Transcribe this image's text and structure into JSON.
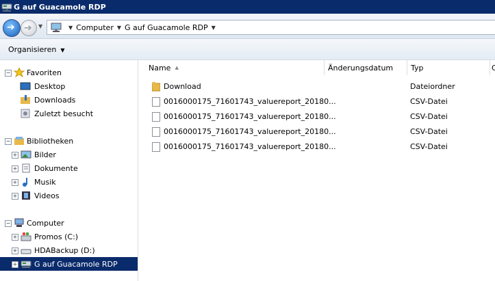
{
  "window": {
    "title": "G auf Guacamole RDP"
  },
  "address": {
    "crumbs": [
      "Computer",
      "G auf Guacamole RDP"
    ]
  },
  "toolbar": {
    "organize_label": "Organisieren"
  },
  "nav": {
    "favorites": {
      "label": "Favoriten",
      "items": [
        "Desktop",
        "Downloads",
        "Zuletzt besucht"
      ]
    },
    "libraries": {
      "label": "Bibliotheken",
      "items": [
        "Bilder",
        "Dokumente",
        "Musik",
        "Videos"
      ]
    },
    "computer": {
      "label": "Computer",
      "items": [
        "Promos (C:)",
        "HDABackup (D:)",
        "G auf Guacamole RDP"
      ]
    }
  },
  "columns": {
    "name": "Name",
    "date": "Änderungsdatum",
    "type": "Typ",
    "size": "G"
  },
  "files": [
    {
      "name": "Download",
      "type": "Dateiordner",
      "icon": "folder-icon"
    },
    {
      "name": "0016000175_71601743_valuereport_20180...",
      "type": "CSV-Datei",
      "icon": "file-icon"
    },
    {
      "name": "0016000175_71601743_valuereport_20180...",
      "type": "CSV-Datei",
      "icon": "file-icon"
    },
    {
      "name": "0016000175_71601743_valuereport_20180...",
      "type": "CSV-Datei",
      "icon": "file-icon"
    },
    {
      "name": "0016000175_71601743_valuereport_20180...",
      "type": "CSV-Datei",
      "icon": "file-icon"
    }
  ],
  "colors": {
    "titlebar": "#0a2b6b",
    "selection": "#0a2b6b",
    "folder": "#e8b84a"
  }
}
